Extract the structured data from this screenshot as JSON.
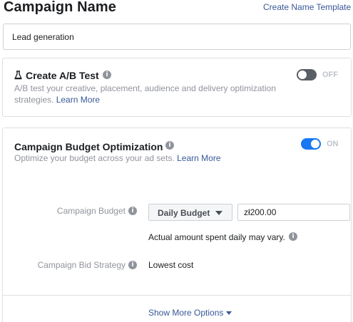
{
  "campaign_name": {
    "title": "Campaign Name",
    "template_link": "Create Name Template",
    "value": "Lead generation"
  },
  "ab_test": {
    "title": "Create A/B Test",
    "description": "A/B test your creative, placement, audience and delivery optimization strategies.",
    "learn_more": "Learn More",
    "toggle_state": "OFF"
  },
  "budget_optimization": {
    "title": "Campaign Budget Optimization",
    "description": "Optimize your budget across your ad sets.",
    "learn_more": "Learn More",
    "toggle_state": "ON",
    "budget_label": "Campaign Budget",
    "budget_type": "Daily Budget",
    "budget_amount": "zł200.00",
    "budget_note": "Actual amount spent daily may vary.",
    "bid_strategy_label": "Campaign Bid Strategy",
    "bid_strategy_value": "Lowest cost",
    "show_more": "Show More Options"
  },
  "colors": {
    "link": "#385898",
    "toggle_on": "#1877f2",
    "toggle_off": "#5a5f66"
  }
}
